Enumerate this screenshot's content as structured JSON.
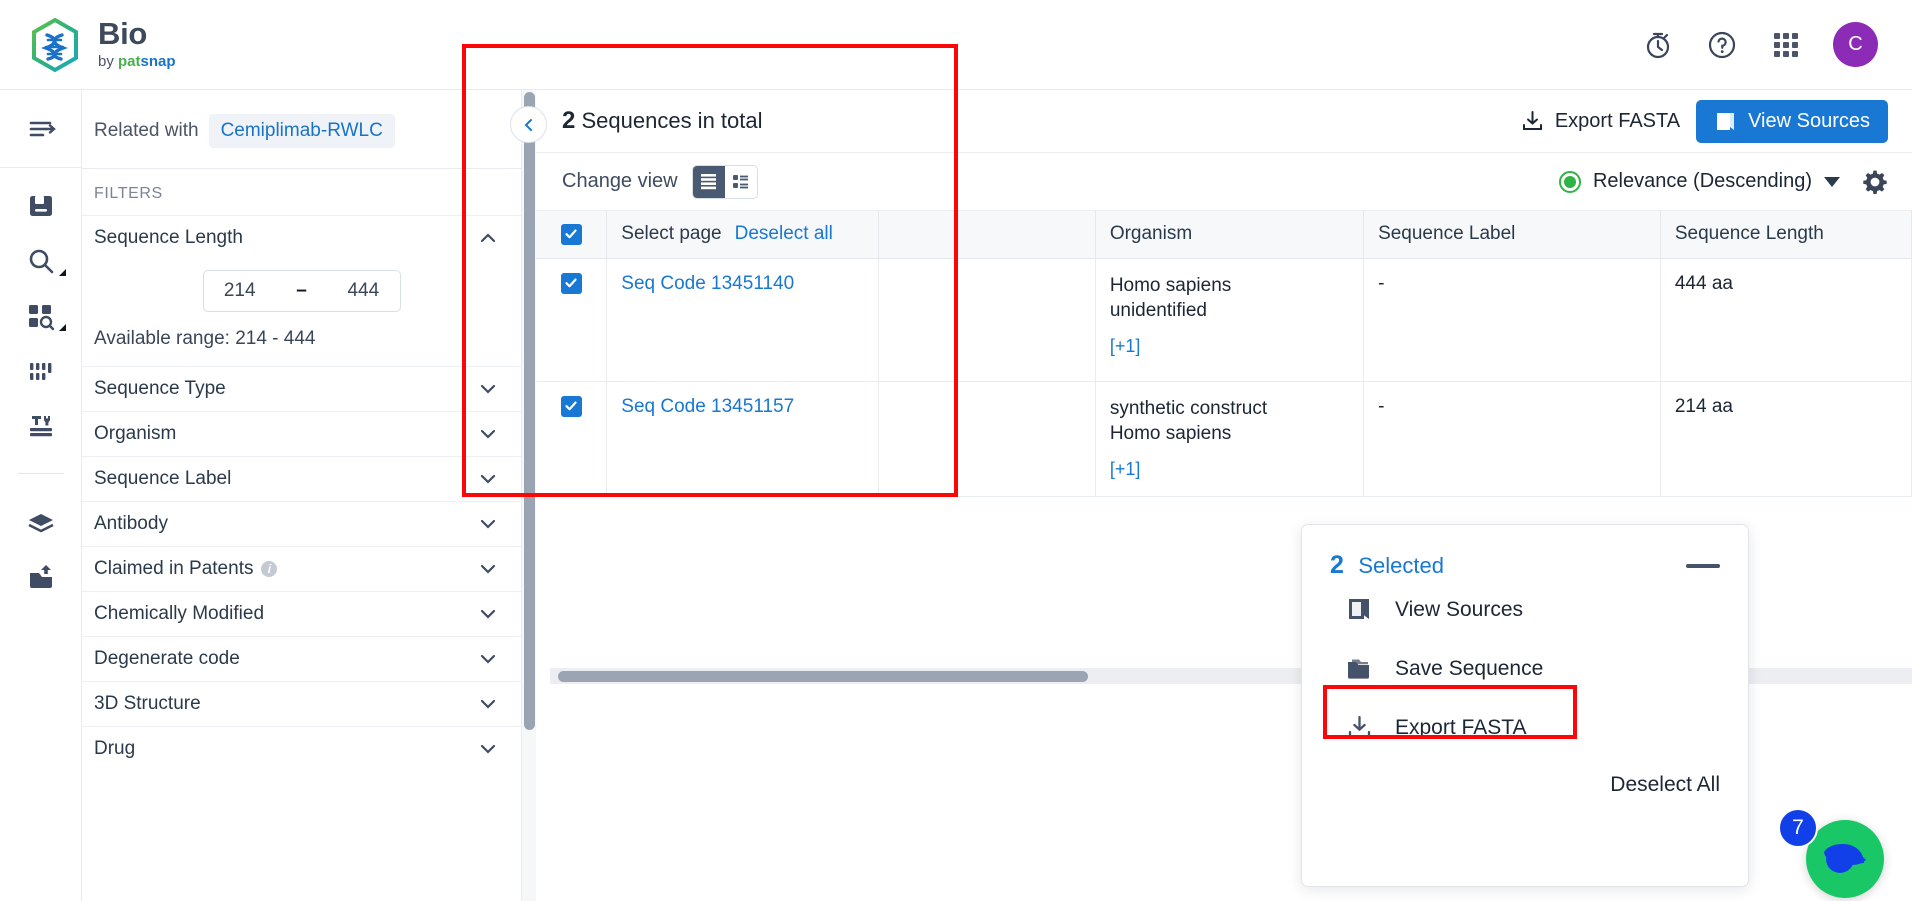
{
  "brand": {
    "title": "Bio",
    "by": "by ",
    "pat": "pat",
    "snap": "snap"
  },
  "topbar": {
    "icons": [
      {
        "name": "stopwatch-icon",
        "label": "Timer"
      },
      {
        "name": "help-icon",
        "label": "Help"
      },
      {
        "name": "apps-grid-icon",
        "label": "Apps"
      }
    ],
    "avatar_initial": "C"
  },
  "rail": {
    "items": [
      {
        "name": "expand-menu-icon",
        "label": "Expand menu"
      },
      {
        "name": "document-icon",
        "label": "Documents"
      },
      {
        "name": "search-icon",
        "label": "Search"
      },
      {
        "name": "grid-search-icon",
        "label": "Advanced search"
      },
      {
        "name": "sequence-bars-icon",
        "label": "Sequences"
      },
      {
        "name": "tools-icon",
        "label": "Tools"
      },
      {
        "name": "layers-icon",
        "label": "Collections"
      },
      {
        "name": "upload-inbox-icon",
        "label": "Uploads"
      }
    ]
  },
  "filters": {
    "related_label": "Related with",
    "related_chip": "Cemiplimab-RWLC",
    "section_title": "FILTERS",
    "sequence_length": {
      "label": "Sequence Length",
      "min": "214",
      "max": "444",
      "dash": "–",
      "available": "Available range: 214 - 444"
    },
    "items": [
      {
        "label": "Sequence Type"
      },
      {
        "label": "Organism"
      },
      {
        "label": "Sequence Label"
      },
      {
        "label": "Antibody"
      },
      {
        "label": "Claimed in Patents",
        "info": true
      },
      {
        "label": "Chemically Modified"
      },
      {
        "label": "Degenerate code"
      },
      {
        "label": "3D Structure"
      },
      {
        "label": "Drug"
      }
    ]
  },
  "main": {
    "total_count": "2",
    "total_text": "Sequences in total",
    "export_fasta": "Export FASTA",
    "view_sources": "View Sources",
    "change_view": "Change view",
    "sort_label": "Relevance (Descending)",
    "select_page": "Select page",
    "deselect_all": "Deselect all",
    "columns": [
      "Organism",
      "Sequence Label",
      "Sequence Length"
    ],
    "rows": [
      {
        "code": "Seq Code 13451140",
        "organism_lines": [
          "Homo sapiens",
          "unidentified"
        ],
        "organism_more": "[+1]",
        "sequence_label": "-",
        "sequence_length": "444 aa",
        "checked": true
      },
      {
        "code": "Seq Code 13451157",
        "organism_lines": [
          "synthetic construct",
          "Homo sapiens"
        ],
        "organism_more": "[+1]",
        "sequence_label": "-",
        "sequence_length": "214 aa",
        "checked": true
      }
    ]
  },
  "selection_panel": {
    "count": "2",
    "selected_label": "Selected",
    "actions": [
      {
        "label": "View Sources",
        "icon": "book-icon"
      },
      {
        "label": "Save Sequence",
        "icon": "folder-icon"
      },
      {
        "label": "Export FASTA",
        "icon": "download-icon"
      }
    ],
    "deselect_all": "Deselect All"
  },
  "chat": {
    "badge": "7"
  },
  "colors": {
    "accent_blue": "#1878d4",
    "brand_green": "#48b04a",
    "avatar_purple": "#8c2bb5",
    "annotation_red": "#fb0707",
    "chat_green": "#19c767"
  }
}
